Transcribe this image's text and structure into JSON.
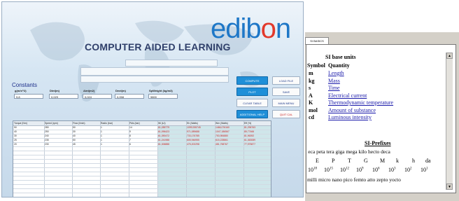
{
  "app": {
    "title": "COMPUTER AIDED LEARNING",
    "logo": {
      "prefix": "edib",
      "o": "o",
      "suffix": "n"
    },
    "constants_title": "Constants",
    "constants": [
      {
        "label": "g(m/s^2)",
        "value": "9,8"
      },
      {
        "label": "Dint(m)",
        "value": "0,029"
      },
      {
        "label": "Aint(m2)",
        "value": "0,024"
      },
      {
        "label": "Dext(m)",
        "value": "0,058"
      },
      {
        "label": "SpWeight (kg/m3)",
        "value": "9800"
      }
    ],
    "buttons": {
      "compute": "COMPUTE",
      "load_file": "LOAD FILE",
      "plot": "PLOT",
      "save": "SAVE",
      "clear_table": "CLEAR TABLE",
      "main_menu": "MAIN MENU",
      "additional_help": "ADDITIONAL HELP",
      "quit": "QUIT CAL"
    },
    "table": {
      "headers": [
        "Torque (Nm)",
        "Speed (rpm)",
        "Flow (l/min)",
        "Radio (bar)",
        "Pdis (bar)",
        "Wi (kJ)",
        "Eh (Watts)",
        "Wm (Watts)",
        "Eff (%)"
      ],
      "rows": [
        [
          "50",
          "280",
          "50",
          "1",
          "14",
          "61,285779",
          "1099,935745",
          "1466,076160",
          "81,296763"
        ],
        [
          "40",
          "250",
          "30",
          "1",
          "9",
          "61,096423",
          "971,089688",
          "1047,186567",
          "85,77466"
        ],
        [
          "30",
          "240",
          "40",
          "1",
          "8",
          "61,390472",
          "733,176785",
          "753,984880",
          "81,96392"
        ],
        [
          "25",
          "235",
          "50",
          "1",
          "7",
          "61,241988",
          "605,946955",
          "615,228861",
          "61,363089"
        ],
        [
          "20",
          "230",
          "45",
          "1",
          "6",
          "61,306888",
          "475,202298",
          "481,758767",
          "77,975877"
        ]
      ]
    }
  },
  "doc_panel": {
    "tab_label": "SI BASICS",
    "heading": "SI base units",
    "col_symbol": "Symbol",
    "col_quantity": "Quantity",
    "units": [
      {
        "symbol": "m",
        "quantity": "Length"
      },
      {
        "symbol": "kg",
        "quantity": "Mass"
      },
      {
        "symbol": "s",
        "quantity": "Time"
      },
      {
        "symbol": "A",
        "quantity": "Electrical current"
      },
      {
        "symbol": "K",
        "quantity": "Thermodynamic temperature"
      },
      {
        "symbol": "mol",
        "quantity": "Amount of substance"
      },
      {
        "symbol": "cd",
        "quantity": "Luminous intensity"
      }
    ],
    "prefixes_heading": "SI-Prefixes",
    "prefix_names": "a eca peta tera giga mega kilo hecto deca",
    "prefix_symbols": [
      "E",
      "P",
      "T",
      "G",
      "M",
      "k",
      "h",
      "da"
    ],
    "prefix_powers": [
      {
        "base": "10",
        "exp": "18"
      },
      {
        "base": "10",
        "exp": "15"
      },
      {
        "base": "10",
        "exp": "12"
      },
      {
        "base": "10",
        "exp": "9"
      },
      {
        "base": "10",
        "exp": "6"
      },
      {
        "base": "10",
        "exp": "3"
      },
      {
        "base": "10",
        "exp": "2"
      },
      {
        "base": "10",
        "exp": "1"
      }
    ],
    "sub_prefixes": "i milli micro nano pico femto atto zepto yocto"
  },
  "colors": {
    "accent": "#1f8fd8",
    "logo_blue": "#1e77c7",
    "logo_red": "#e2392c",
    "calc_values": "#cc2222"
  }
}
